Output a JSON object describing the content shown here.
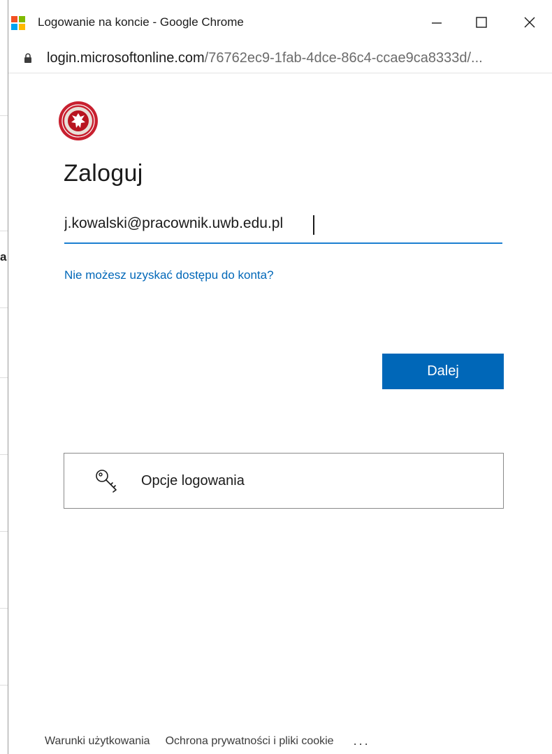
{
  "window": {
    "title": "Logowanie na koncie - Google Chrome",
    "minimize_symbol": "—",
    "maximize_symbol": "☐",
    "close_symbol": "✕"
  },
  "address_bar": {
    "host": "login.microsoftonline.com",
    "path": "/76762ec9-1fab-4dce-86c4-ccae9ca8333d/..."
  },
  "background": {
    "visible_char": "a"
  },
  "signin": {
    "heading": "Zaloguj",
    "email_value": "j.kowalski@pracownik.uwb.edu.pl",
    "help_link": "Nie możesz uzyskać dostępu do konta?",
    "next_button": "Dalej",
    "options_button": "Opcje logowania"
  },
  "footer": {
    "terms": "Warunki użytkowania",
    "privacy": "Ochrona prywatności i pliki cookie",
    "more": "..."
  },
  "colors": {
    "accent": "#0067b8",
    "input_underline": "#1c7fd1",
    "logo_red": "#c8202f",
    "ms_red": "#f25022",
    "ms_green": "#7fba00",
    "ms_blue": "#00a4ef",
    "ms_yellow": "#ffb900"
  },
  "icons": {
    "app": "microsoft-logo-icon",
    "lock": "lock-icon",
    "logo": "university-seal-icon",
    "options": "key-icon"
  }
}
